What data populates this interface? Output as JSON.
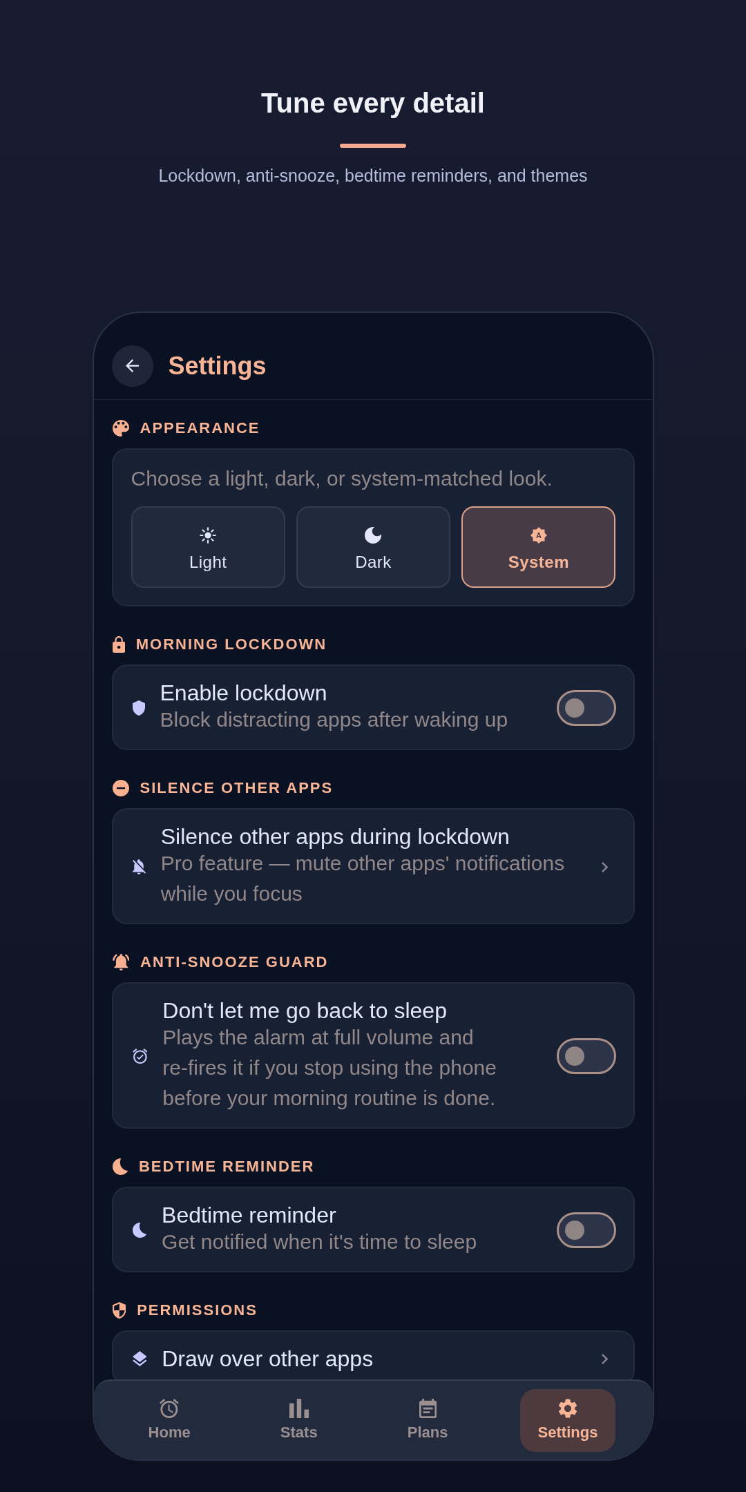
{
  "hero": {
    "title": "Tune every detail",
    "subtitle": "Lockdown, anti-snooze, bedtime reminders, and themes"
  },
  "app_bar": {
    "title": "Settings"
  },
  "sections": [
    {
      "kind": "choice",
      "label": "APPEARANCE",
      "description": "Choose a light, dark, or system-matched look.",
      "options": [
        {
          "label": "Light",
          "selected": false
        },
        {
          "label": "Dark",
          "selected": false
        },
        {
          "label": "System",
          "icon_text": "A",
          "selected": true
        }
      ]
    },
    {
      "kind": "setting",
      "label": "MORNING LOCKDOWN",
      "row": {
        "kind": "toggle",
        "title": "Enable lockdown",
        "subtitle": "Block distracting apps after waking up",
        "on": false
      }
    },
    {
      "kind": "setting",
      "label": "SILENCE OTHER APPS",
      "row": {
        "kind": "link",
        "title": "Silence other apps during lockdown",
        "subtitle": "Pro feature — mute other apps' notifications while you focus"
      }
    },
    {
      "kind": "setting",
      "label": "ANTI-SNOOZE GUARD",
      "row": {
        "kind": "toggle",
        "title": "Don't let me go back to sleep",
        "subtitle": "Plays the alarm at full volume and re-fires it if you stop using the phone before your morning routine is done.",
        "on": false
      }
    },
    {
      "kind": "setting",
      "label": "BEDTIME REMINDER",
      "row": {
        "kind": "toggle",
        "title": "Bedtime reminder",
        "subtitle": "Get notified when it's time to sleep",
        "on": false
      }
    },
    {
      "kind": "setting",
      "label": "PERMISSIONS",
      "row": {
        "kind": "link",
        "title": "Draw over other apps"
      }
    }
  ],
  "bottom_nav": [
    {
      "label": "Home",
      "selected": false
    },
    {
      "label": "Stats",
      "selected": false
    },
    {
      "label": "Plans",
      "selected": false
    },
    {
      "label": "Settings",
      "selected": true
    }
  ]
}
